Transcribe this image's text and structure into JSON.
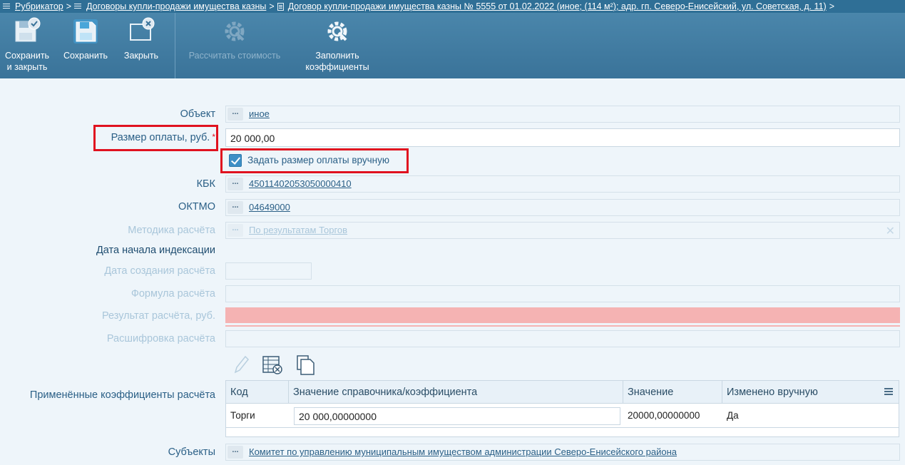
{
  "breadcrumb": {
    "items": [
      {
        "icon": "list-icon",
        "label": "Рубрикатор"
      },
      {
        "icon": "list-icon",
        "label": "Договоры купли-продажи имущества казны"
      },
      {
        "icon": "document-icon",
        "label": "Договор купли-продажи имущества казны № 5555 от 01.02.2022 (иное; (114 м²); адр. гп. Северо-Енисейский, ул. Советская, д. 11)"
      }
    ],
    "separator": ">"
  },
  "toolbar": {
    "save_close": {
      "line1": "Сохранить",
      "line2": "и закрыть",
      "icon": "save-check-icon"
    },
    "save": {
      "label": "Сохранить",
      "icon": "save-icon"
    },
    "close": {
      "label": "Закрыть",
      "icon": "close-window-icon"
    },
    "calc_cost": {
      "label": "Рассчитать стоимость",
      "icon": "gear-wrench-icon"
    },
    "fill_coeffs": {
      "line1": "Заполнить",
      "line2": "коэффициенты",
      "icon": "gear-wrench-icon"
    }
  },
  "form": {
    "object": {
      "label": "Объект",
      "value": "иное"
    },
    "payment": {
      "label": "Размер оплаты, руб.",
      "required_mark": "*",
      "value": "20 000,00"
    },
    "manual_checkbox": {
      "label": "Задать размер оплаты вручную",
      "checked": true
    },
    "kbk": {
      "label": "КБК",
      "value": "45011402053050000410"
    },
    "oktmo": {
      "label": "ОКТМО",
      "value": "04649000"
    },
    "method": {
      "label": "Методика расчёта",
      "value": "По результатам Торгов"
    },
    "indexation_date": {
      "label": "Дата начала индексации"
    },
    "calc_created": {
      "label": "Дата создания расчёта"
    },
    "formula": {
      "label": "Формула расчёта"
    },
    "result": {
      "label": "Результат расчёта, руб."
    },
    "decoding": {
      "label": "Расшифровка расчёта"
    },
    "coefficients": {
      "label": "Применённые коэффициенты расчёта",
      "columns": [
        "Код",
        "Значение справочника/коэффициента",
        "Значение",
        "Изменено вручную"
      ],
      "rows": [
        {
          "code": "Торги",
          "ref_value": "20 000,00000000",
          "value": "20000,00000000",
          "manual": "Да"
        }
      ]
    },
    "subjects": {
      "label": "Субъекты",
      "value": "Комитет по управлению муниципальным имуществом администрации Северо-Енисейского района"
    }
  },
  "colors": {
    "accent": "#3a7399",
    "highlight": "#e0121f",
    "error_field": "#f5b3b3"
  }
}
